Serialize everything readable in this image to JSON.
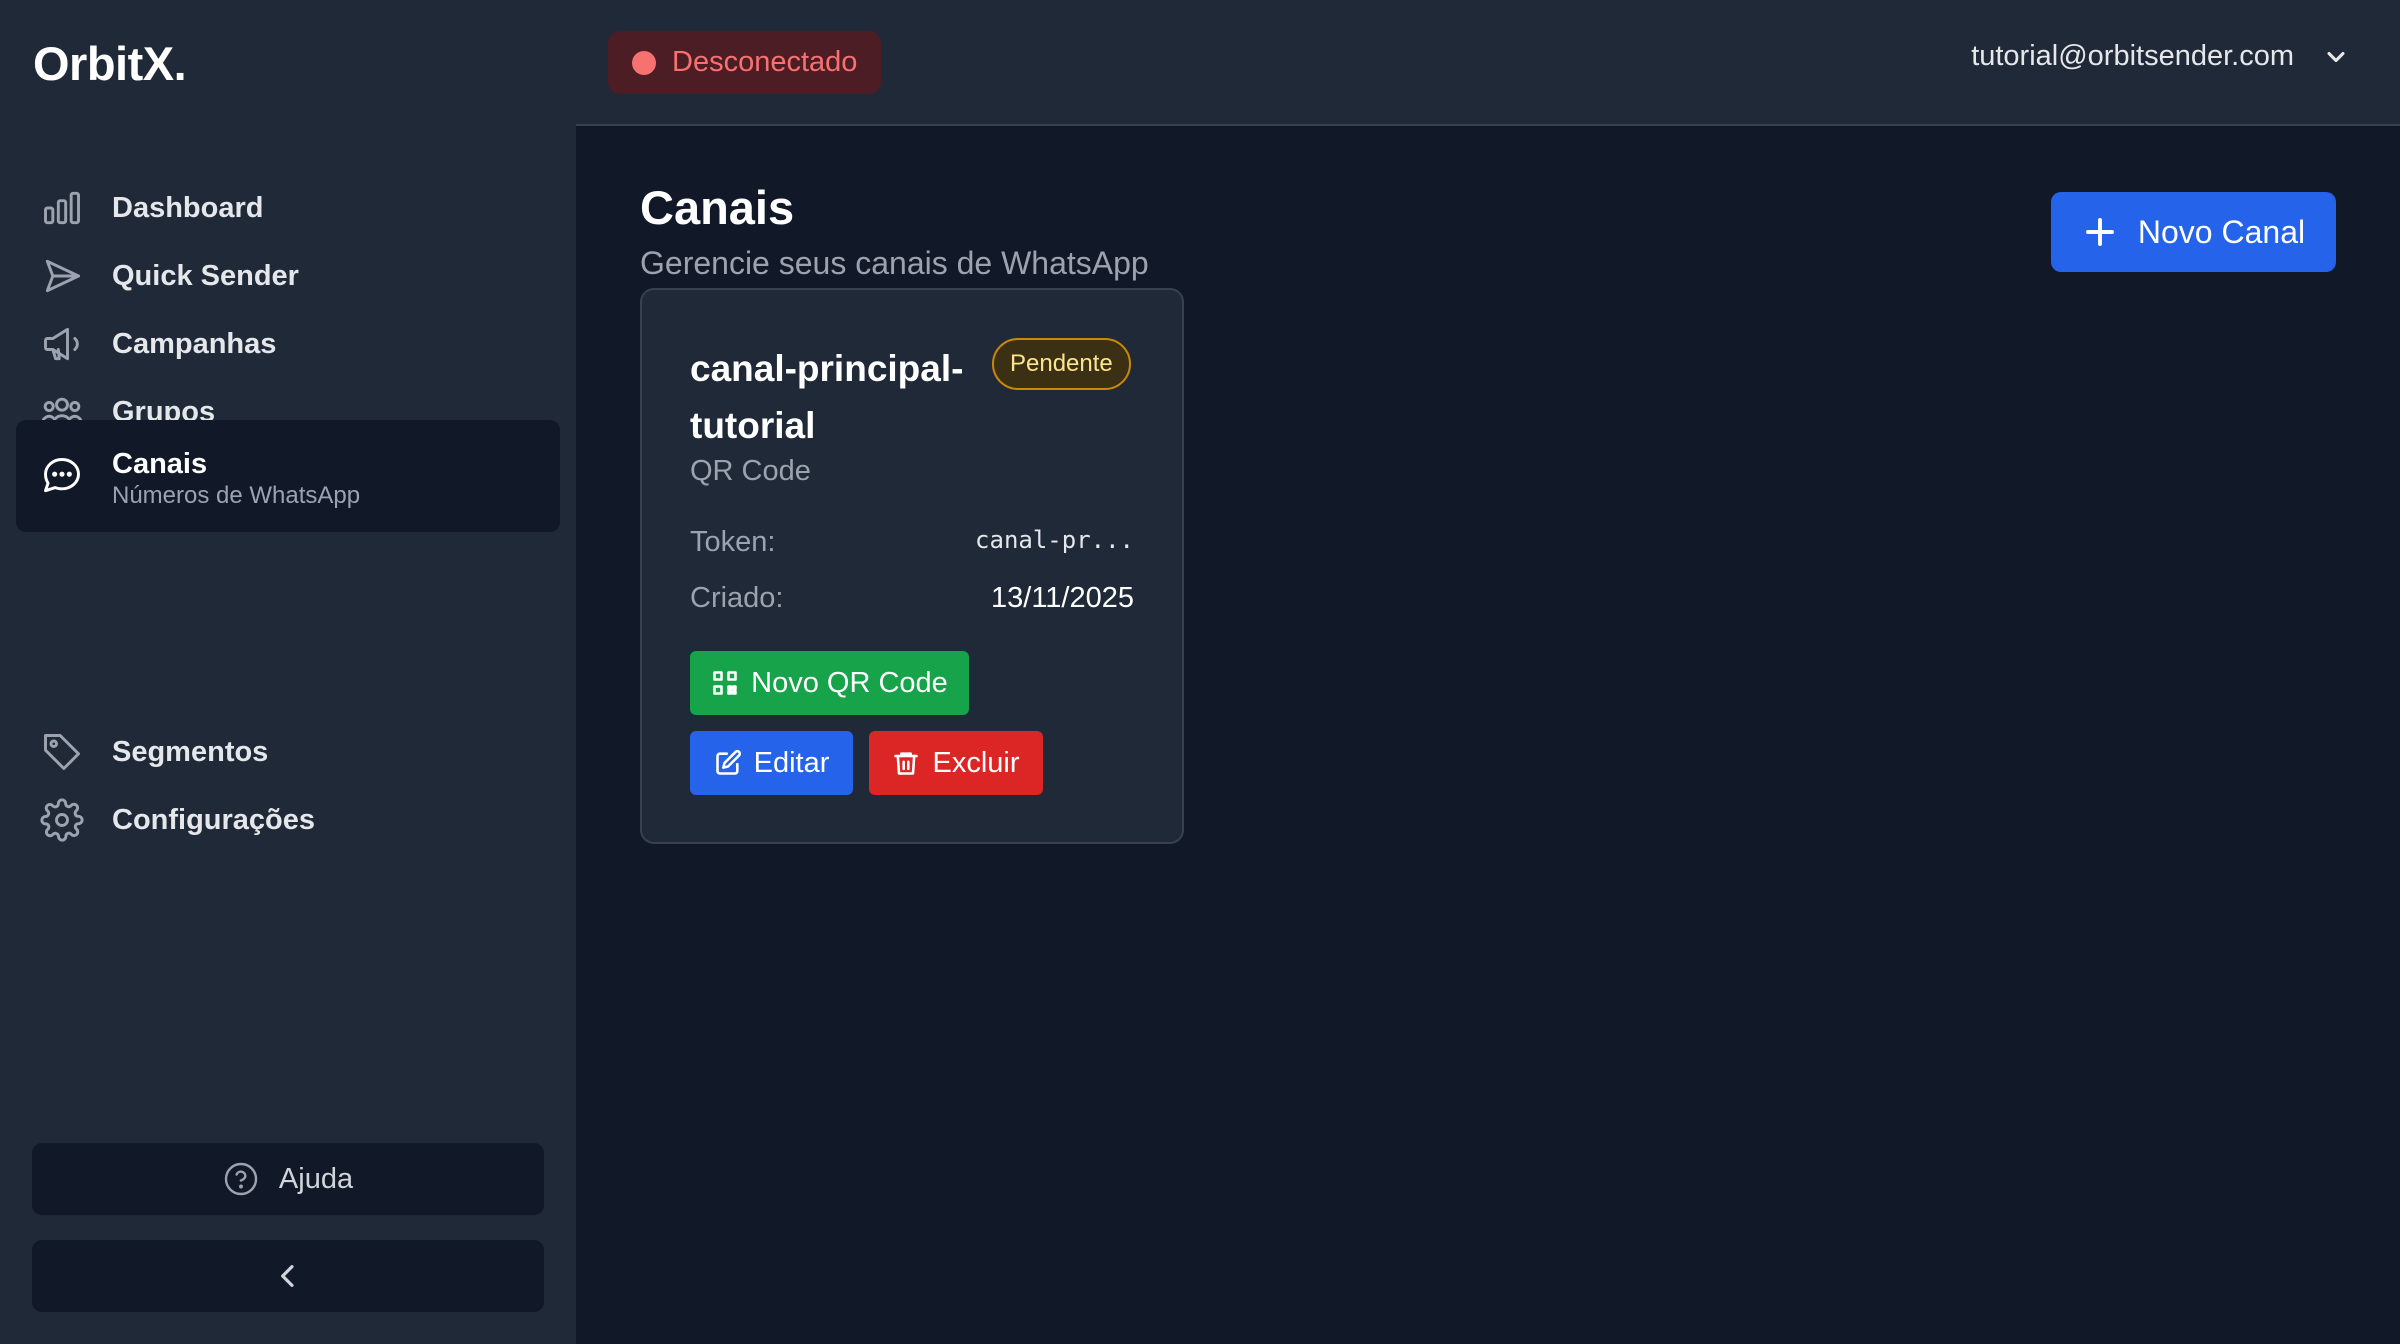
{
  "app": {
    "logo": "OrbitX."
  },
  "sidebar": {
    "items": [
      {
        "label": "Dashboard",
        "icon": "bar-chart-icon"
      },
      {
        "label": "Quick Sender",
        "icon": "send-icon"
      },
      {
        "label": "Campanhas",
        "icon": "megaphone-icon"
      },
      {
        "label": "Grupos",
        "icon": "users-group-icon"
      },
      {
        "label": "Canais",
        "sublabel": "Números de WhatsApp",
        "icon": "chat-bubble-icon",
        "active": true
      },
      {
        "label": "Segmentos",
        "icon": "tag-icon"
      },
      {
        "label": "Configurações",
        "icon": "gear-icon"
      }
    ],
    "help_label": "Ajuda"
  },
  "header": {
    "status": "Desconectado",
    "status_color": "#f87171",
    "user_email": "tutorial@orbitsender.com"
  },
  "main": {
    "title": "Canais",
    "subtitle": "Gerencie seus canais de WhatsApp",
    "new_channel_label": "Novo Canal"
  },
  "channel_card": {
    "name": "canal-principal-tutorial",
    "status_badge": "Pendente",
    "type": "QR Code",
    "token_label": "Token:",
    "token_value": "canal-pr...",
    "created_label": "Criado:",
    "created_value": "13/11/2025",
    "qr_button_label": "Novo QR Code",
    "edit_button_label": "Editar",
    "delete_button_label": "Excluir"
  },
  "colors": {
    "accent": "#2563eb",
    "success": "#16a34a",
    "danger": "#dc2626",
    "pending": "#ca8a04"
  }
}
